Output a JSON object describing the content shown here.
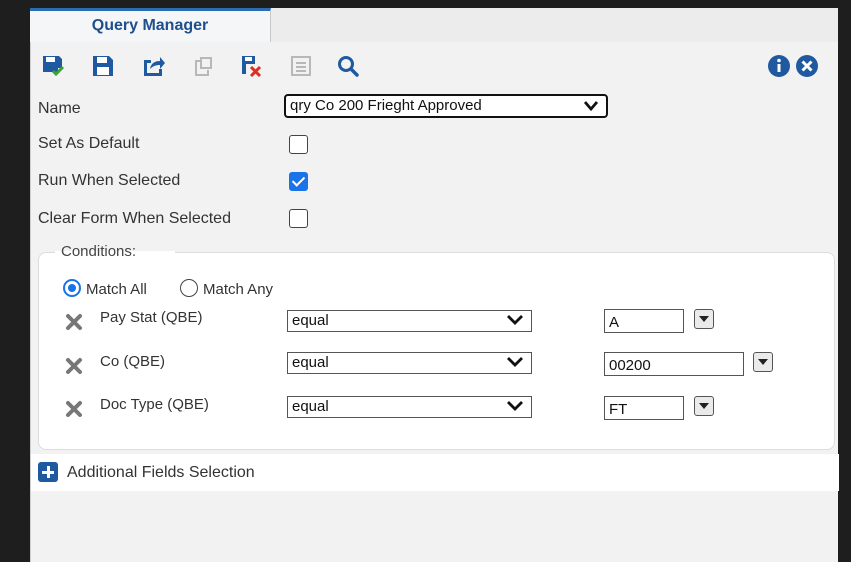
{
  "window": {
    "tab_title": "Query Manager"
  },
  "toolbar": {
    "icons": [
      "save-and-approve-icon",
      "save-icon",
      "share-icon",
      "copy-icon",
      "delete-icon",
      "notes-icon",
      "search-icon",
      "info-icon",
      "close-icon"
    ],
    "accent": "#1f5aa0"
  },
  "form": {
    "name_label": "Name",
    "name_value": "qry Co 200 Frieght Approved",
    "set_default_label": "Set As Default",
    "set_default_checked": false,
    "run_when_selected_label": "Run When Selected",
    "run_when_selected_checked": true,
    "clear_form_label": "Clear Form When Selected",
    "clear_form_checked": false
  },
  "conditions": {
    "legend": "Conditions:",
    "match_all_label": "Match All",
    "match_any_label": "Match Any",
    "selected_match": "all",
    "rows": [
      {
        "field": "Pay Stat (QBE)",
        "operator": "equal",
        "value": "A"
      },
      {
        "field": "Co (QBE)",
        "operator": "equal",
        "value": "00200"
      },
      {
        "field": "Doc Type (QBE)",
        "operator": "equal",
        "value": "FT"
      }
    ]
  },
  "additional": {
    "label": "Additional Fields Selection"
  }
}
